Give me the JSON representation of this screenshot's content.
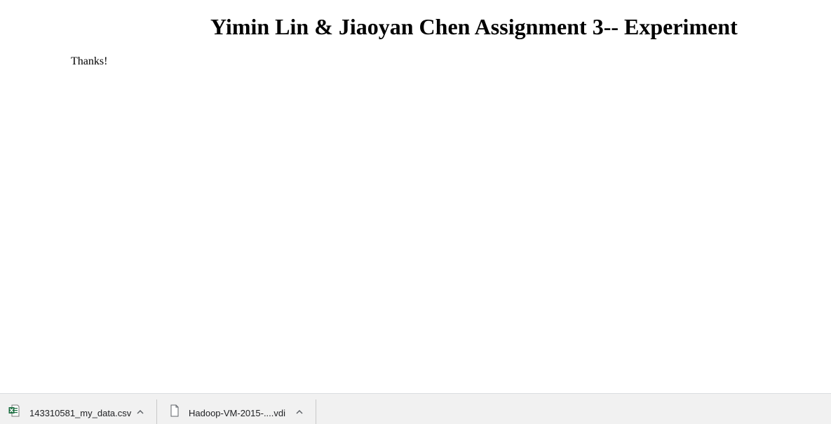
{
  "page": {
    "title": "Yimin Lin & Jiaoyan Chen Assignment 3-- Experiment",
    "message": "Thanks!"
  },
  "downloads": [
    {
      "filename": "143310581_my_data.csv",
      "icon": "excel-csv-file-icon",
      "icon_color": "#1d6f42"
    },
    {
      "filename": "Hadoop-VM-2015-....vdi",
      "icon": "generic-file-icon",
      "icon_color": "#5f6368"
    }
  ],
  "colors": {
    "download_bar_bg": "#f1f1f1",
    "text": "#202124"
  }
}
